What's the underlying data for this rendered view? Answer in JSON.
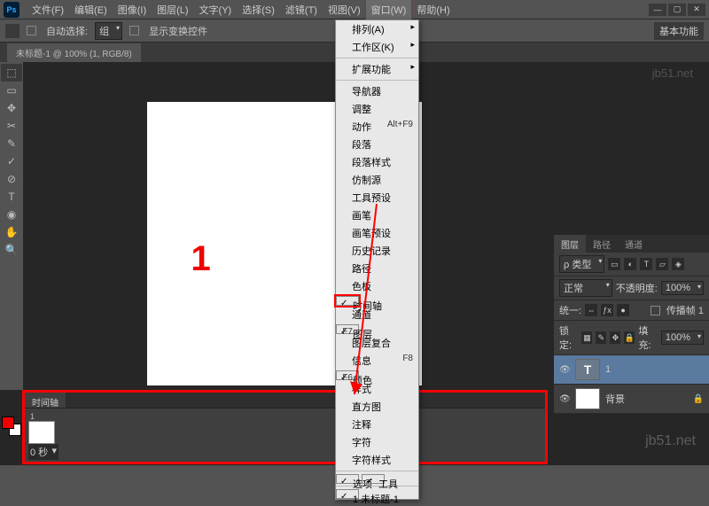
{
  "app": {
    "logo": "Ps"
  },
  "menubar": {
    "items": [
      "文件(F)",
      "编辑(E)",
      "图像(I)",
      "图层(L)",
      "文字(Y)",
      "选择(S)",
      "滤镜(T)",
      "视图(V)",
      "窗口(W)",
      "帮助(H)"
    ],
    "highlighted_index": 8
  },
  "window_menu": {
    "items": [
      {
        "label": "排列(A)",
        "sub": true
      },
      {
        "label": "工作区(K)",
        "sub": true
      },
      {
        "sep": true
      },
      {
        "label": "扩展功能",
        "sub": true
      },
      {
        "sep": true
      },
      {
        "label": "导航器"
      },
      {
        "label": "调整"
      },
      {
        "label": "动作",
        "shortcut": "Alt+F9"
      },
      {
        "label": "段落"
      },
      {
        "label": "段落样式"
      },
      {
        "label": "仿制源"
      },
      {
        "label": "工具预设"
      },
      {
        "label": "画笔"
      },
      {
        "label": "画笔预设"
      },
      {
        "label": "历史记录"
      },
      {
        "label": "路径"
      },
      {
        "label": "色板"
      },
      {
        "label": "时间轴",
        "checked": true,
        "hl": true
      },
      {
        "label": "通道"
      },
      {
        "label": "图层",
        "checked": true,
        "shortcut": "F7"
      },
      {
        "label": "图层复合"
      },
      {
        "label": "信息",
        "shortcut": "F8"
      },
      {
        "label": "颜色",
        "checked": true,
        "shortcut": "F6"
      },
      {
        "label": "样式"
      },
      {
        "label": "直方图"
      },
      {
        "label": "注释"
      },
      {
        "label": "字符"
      },
      {
        "label": "字符样式"
      },
      {
        "sep": true
      },
      {
        "label": "选项",
        "checked": true
      },
      {
        "label": "工具",
        "checked": true
      },
      {
        "sep": true
      },
      {
        "label": "1 未标题-1",
        "checked": true
      }
    ]
  },
  "optionbar": {
    "auto_select": "自动选择:",
    "group": "组",
    "show_transform": "显示变换控件",
    "right": "基本功能"
  },
  "doc_tab": "未标题-1 @ 100% (1, RGB/8) ",
  "canvas": {
    "text": "1"
  },
  "tools": [
    "⬚",
    "▭",
    "✥",
    "✂",
    "✎",
    "✓",
    "⊘",
    "T",
    "◉",
    "✋",
    "🔍"
  ],
  "panels": {
    "tabs": [
      "图层",
      "路径",
      "通道"
    ],
    "kind": "ρ 类型",
    "blend": "正常",
    "opacity_label": "不透明度:",
    "opacity": "100%",
    "unify": "统一:",
    "propagate": "传播帧 1",
    "lock": "锁定:",
    "fill_label": "填充:",
    "fill": "100%",
    "layers": [
      {
        "name": "1",
        "text_thumb": "T"
      },
      {
        "name": "背景"
      }
    ]
  },
  "timeline": {
    "tab": "时间轴",
    "frame_index": "1",
    "frame_delay": "0 秒"
  },
  "watermark": "jb51.net",
  "watermark2": "jb51.net"
}
